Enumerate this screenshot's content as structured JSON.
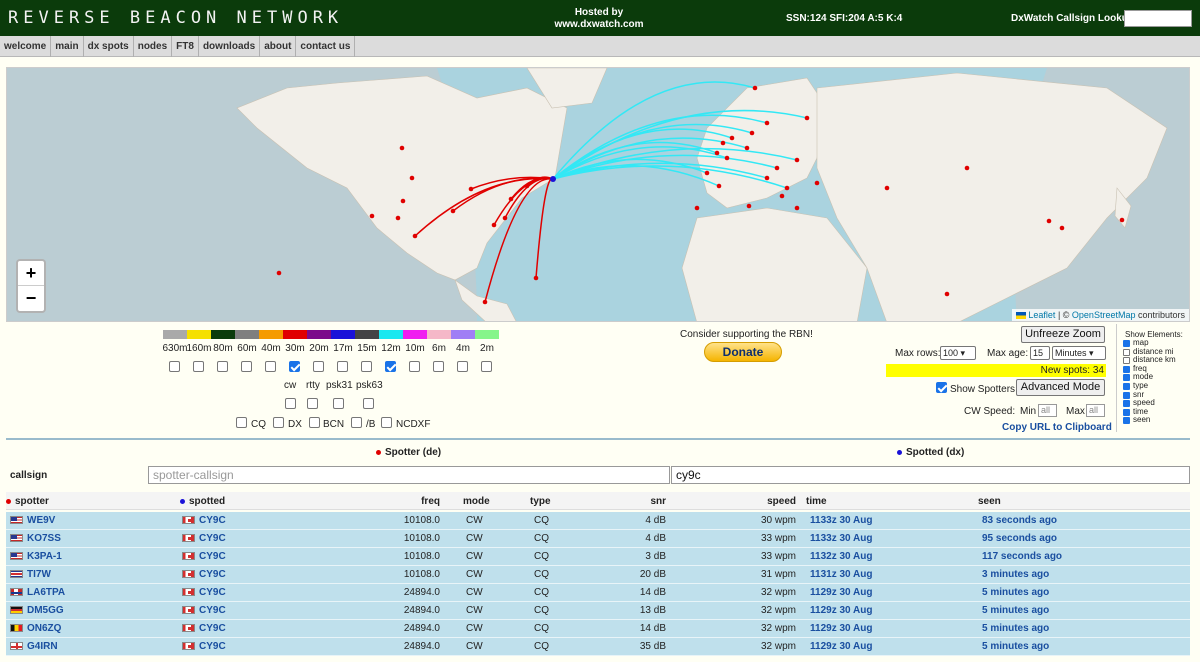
{
  "header": {
    "logo": "REVERSE BEACON NETWORK",
    "hosted_line1": "Hosted by",
    "hosted_line2": "www.dxwatch.com",
    "solar": "SSN:124 SFI:204 A:5 K:4",
    "lookup_label": "DxWatch Callsign Lookup:",
    "lookup_value": ""
  },
  "nav": [
    "welcome",
    "main",
    "dx spots",
    "nodes",
    "FT8",
    "downloads",
    "about",
    "contact us"
  ],
  "map": {
    "zoom_in": "+",
    "zoom_out": "−",
    "attr_leaflet": "Leaflet",
    "attr_sep": " | © ",
    "attr_osm": "OpenStreetMap",
    "attr_tail": " contributors",
    "colors": {
      "water": "#aad3df",
      "land": "#f2efe9",
      "night": "#c8c8c8",
      "spotter": "#e00000",
      "path_na": "#e00000",
      "path_eu": "#33e8f5"
    }
  },
  "bands": [
    {
      "label": "630m",
      "color": "#a9a9a9",
      "checked": false
    },
    {
      "label": "160m",
      "color": "#f5e000",
      "checked": false
    },
    {
      "label": "80m",
      "color": "#0b3b0b",
      "checked": false
    },
    {
      "label": "60m",
      "color": "#7f7f7f",
      "checked": false
    },
    {
      "label": "40m",
      "color": "#f59b00",
      "checked": false
    },
    {
      "label": "30m",
      "color": "#e00000",
      "checked": true
    },
    {
      "label": "20m",
      "color": "#7b0a8a",
      "checked": false
    },
    {
      "label": "17m",
      "color": "#1a12d8",
      "checked": false
    },
    {
      "label": "15m",
      "color": "#444444",
      "checked": false
    },
    {
      "label": "12m",
      "color": "#19e8f0",
      "checked": true
    },
    {
      "label": "10m",
      "color": "#f01ef0",
      "checked": false
    },
    {
      "label": "6m",
      "color": "#f5b8c8",
      "checked": false
    },
    {
      "label": "4m",
      "color": "#a07ef5",
      "checked": false
    },
    {
      "label": "2m",
      "color": "#86f58a",
      "checked": false
    }
  ],
  "modes": [
    "cw",
    "rtty",
    "psk31",
    "psk63"
  ],
  "types": [
    "CQ",
    "DX",
    "BCN",
    "/B",
    "NCDXF"
  ],
  "support_text": "Consider supporting the RBN!",
  "donate_label": "Donate",
  "unfreeze_label": "Unfreeze Zoom",
  "max_rows_label": "Max rows:",
  "max_rows_value": "100",
  "max_age_label": "Max age:",
  "max_age_value": "15",
  "max_age_unit": "Minutes",
  "new_spots": "New spots: 34",
  "show_spotters_label": "Show Spotters",
  "advanced_label": "Advanced Mode",
  "cw_speed_label": "CW Speed:",
  "min_label": "Min",
  "max_label": "Max",
  "all_placeholder": "all",
  "copy_url": "Copy URL to Clipboard",
  "show_elements": {
    "title": "Show Elements:",
    "items": [
      {
        "label": "map",
        "checked": true
      },
      {
        "label": "distance mi",
        "checked": false
      },
      {
        "label": "distance km",
        "checked": false
      },
      {
        "label": "freq",
        "checked": true
      },
      {
        "label": "mode",
        "checked": true
      },
      {
        "label": "type",
        "checked": true
      },
      {
        "label": "snr",
        "checked": true
      },
      {
        "label": "speed",
        "checked": true
      },
      {
        "label": "time",
        "checked": true
      },
      {
        "label": "seen",
        "checked": true
      }
    ]
  },
  "table": {
    "spotter_hdr": "Spotter (de)",
    "spotted_hdr": "Spotted (dx)",
    "callsign_label": "callsign",
    "spotter_placeholder": "spotter-callsign",
    "spotted_value": "cy9c",
    "columns": [
      "spotter",
      "spotted",
      "freq",
      "mode",
      "type",
      "snr",
      "speed",
      "time",
      "seen"
    ],
    "rows": [
      {
        "flag": "us",
        "spotter": "WE9V",
        "spotted": "CY9C",
        "freq": "10108.0",
        "mode": "CW",
        "type": "CQ",
        "snr": "4 dB",
        "speed": "30 wpm",
        "time": "1133z 30 Aug",
        "seen": "83 seconds ago"
      },
      {
        "flag": "us",
        "spotter": "KO7SS",
        "spotted": "CY9C",
        "freq": "10108.0",
        "mode": "CW",
        "type": "CQ",
        "snr": "4 dB",
        "speed": "33 wpm",
        "time": "1133z 30 Aug",
        "seen": "95 seconds ago"
      },
      {
        "flag": "us",
        "spotter": "K3PA-1",
        "spotted": "CY9C",
        "freq": "10108.0",
        "mode": "CW",
        "type": "CQ",
        "snr": "3 dB",
        "speed": "33 wpm",
        "time": "1132z 30 Aug",
        "seen": "117 seconds ago"
      },
      {
        "flag": "cr",
        "spotter": "TI7W",
        "spotted": "CY9C",
        "freq": "10108.0",
        "mode": "CW",
        "type": "CQ",
        "snr": "20 dB",
        "speed": "31 wpm",
        "time": "1131z 30 Aug",
        "seen": "3 minutes ago"
      },
      {
        "flag": "no",
        "spotter": "LA6TPA",
        "spotted": "CY9C",
        "freq": "24894.0",
        "mode": "CW",
        "type": "CQ",
        "snr": "14 dB",
        "speed": "32 wpm",
        "time": "1129z 30 Aug",
        "seen": "5 minutes ago"
      },
      {
        "flag": "de",
        "spotter": "DM5GG",
        "spotted": "CY9C",
        "freq": "24894.0",
        "mode": "CW",
        "type": "CQ",
        "snr": "13 dB",
        "speed": "32 wpm",
        "time": "1129z 30 Aug",
        "seen": "5 minutes ago"
      },
      {
        "flag": "be",
        "spotter": "ON6ZQ",
        "spotted": "CY9C",
        "freq": "24894.0",
        "mode": "CW",
        "type": "CQ",
        "snr": "14 dB",
        "speed": "32 wpm",
        "time": "1129z 30 Aug",
        "seen": "5 minutes ago"
      },
      {
        "flag": "en",
        "spotter": "G4IRN",
        "spotted": "CY9C",
        "freq": "24894.0",
        "mode": "CW",
        "type": "CQ",
        "snr": "35 dB",
        "speed": "32 wpm",
        "time": "1129z 30 Aug",
        "seen": "5 minutes ago"
      }
    ]
  }
}
